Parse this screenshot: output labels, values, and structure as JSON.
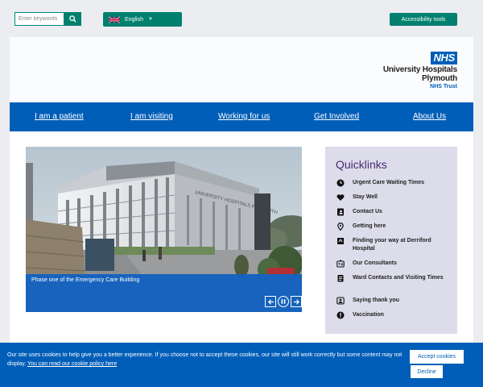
{
  "utility": {
    "search_placeholder": "Enter keywords",
    "language": "English",
    "accessibility": "Accessibility tools"
  },
  "logo": {
    "badge": "NHS",
    "name_line1": "University Hospitals",
    "name_line2": "Plymouth",
    "trust": "NHS Trust"
  },
  "nav": {
    "items": [
      "I am a patient",
      "I am visiting",
      "Working for us",
      "Get Involved",
      "About Us"
    ]
  },
  "carousel": {
    "caption": "Phase one of the Emergency Care Building",
    "building_sign": "UNIVERSITY HOSPITALS PLYMOUTH"
  },
  "quicklinks": {
    "title": "Quicklinks",
    "items": [
      {
        "label": "Urgent Care Waiting Times",
        "icon": "clock-icon"
      },
      {
        "label": "Stay Well",
        "icon": "heart-icon"
      },
      {
        "label": "Contact Us",
        "icon": "contact-card-icon"
      },
      {
        "label": "Getting here",
        "icon": "location-pin-icon"
      },
      {
        "label": "Finding your way at Derriford Hospital",
        "icon": "map-icon"
      },
      {
        "label": "Our Consultants",
        "icon": "id-badge-icon"
      },
      {
        "label": "Ward Contacts and Visiting Times",
        "icon": "clipboard-icon"
      },
      {
        "label": "Saying thank you",
        "icon": "thank-you-icon"
      },
      {
        "label": "Vaccination",
        "icon": "alert-icon"
      }
    ]
  },
  "cookie": {
    "message": "Our site uses cookies to help give you a better experience. If you choose not to accept these cookies, our site will still work correctly but some content may not display.",
    "link": "You can read our cookie policy here",
    "accept": "Accept cookies",
    "decline": "Decline"
  },
  "colors": {
    "nhs_blue": "#005eb8",
    "teal": "#00806f",
    "quicklinks_bg": "#dcdceb",
    "quicklinks_title": "#4a2c73"
  }
}
